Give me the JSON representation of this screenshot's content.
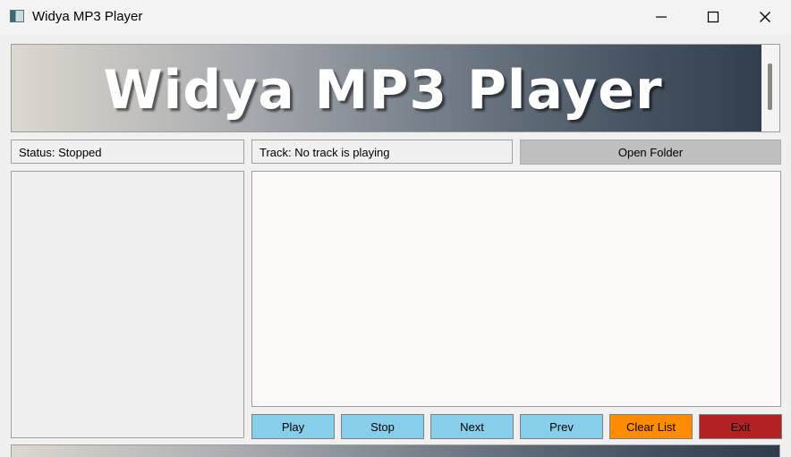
{
  "window": {
    "title": "Widya MP3 Player",
    "controls": {
      "minimize": "minimize-icon",
      "maximize": "maximize-icon",
      "close": "close-icon"
    }
  },
  "banner": {
    "title": "Widya MP3 Player"
  },
  "status": {
    "text": "Status: Stopped"
  },
  "track": {
    "text": "Track: No track is playing"
  },
  "actions": {
    "open_folder": "Open Folder"
  },
  "playlist": {
    "items": []
  },
  "controls": [
    {
      "id": "play",
      "label": "Play",
      "color": "#87ceeb"
    },
    {
      "id": "stop",
      "label": "Stop",
      "color": "#87ceeb"
    },
    {
      "id": "next",
      "label": "Next",
      "color": "#87ceeb"
    },
    {
      "id": "prev",
      "label": "Prev",
      "color": "#87ceeb"
    },
    {
      "id": "clear-list",
      "label": "Clear List",
      "color": "#ff8c00"
    },
    {
      "id": "exit",
      "label": "Exit",
      "color": "#b22222"
    }
  ]
}
